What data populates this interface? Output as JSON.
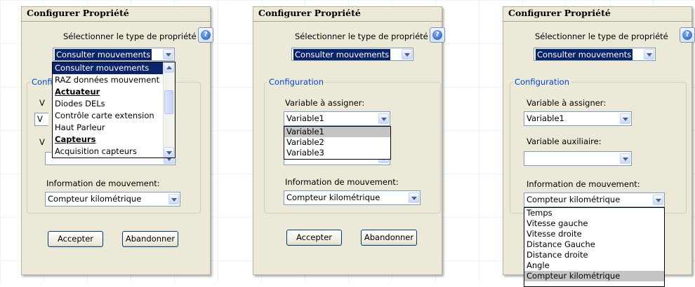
{
  "dialog_title": "Configurer Propriété",
  "property_type_label": "Sélectionner le type de propriété",
  "property_type_value": "Consulter mouvements",
  "group_label": "Configuration",
  "variable_label": "Variable à assigner:",
  "variable_value": "Variable1",
  "aux_label": "Variable auxiliaire:",
  "aux_value": "",
  "movement_label": "Information de mouvement:",
  "movement_value": "Compteur kilométrique",
  "accept_label": "Accepter",
  "cancel_label": "Abandonner",
  "help_glyph": "?",
  "panel1_partial": {
    "group_label_clip": "Confi",
    "variable_label_clip": "V",
    "variable_value_clip": "V",
    "aux_label_clip": "V"
  },
  "property_type_options": [
    "Consulter mouvements",
    "RAZ données mouvement",
    "Actuateur",
    "Diodes DELs",
    "Contrôle carte extension",
    "Haut Parleur",
    "Capteurs",
    "Acquisition capteurs"
  ],
  "variable_options": [
    "Variable1",
    "Variable2",
    "Variable3"
  ],
  "movement_options": [
    "Temps",
    "Vitesse gauche",
    "Vitesse droite",
    "Distance Gauche",
    "Distance droite",
    "Angle",
    "Compteur kilométrique"
  ],
  "icons": {
    "help": "help-icon",
    "dropdown": "chevron-down-icon"
  },
  "colors": {
    "dialog_bg": "#ece9d8",
    "selection": "#0a246a",
    "group_label": "#0046d5"
  }
}
